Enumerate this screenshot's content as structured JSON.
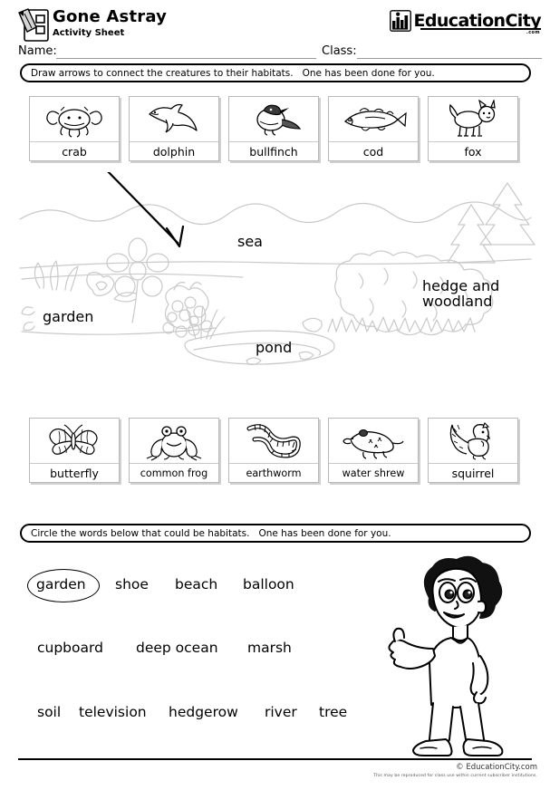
{
  "header": {
    "title": "Gone Astray",
    "subtitle": "Activity Sheet",
    "name_label": "Name:",
    "class_label": "Class:",
    "brand": "EducationCity",
    "brand_tld": ".com",
    "logo_icon": "pencil-clipboard-icon",
    "brand_icon": "cityscape-icon"
  },
  "instructions": {
    "task1": "Draw arrows to connect the creatures to their habitats.   One has been done for you.",
    "task2": "Circle the words below that could be habitats.   One has been done for you."
  },
  "creatures_top": [
    {
      "label": "crab",
      "icon": "crab-icon"
    },
    {
      "label": "dolphin",
      "icon": "dolphin-icon"
    },
    {
      "label": "bullfinch",
      "icon": "bullfinch-icon"
    },
    {
      "label": "cod",
      "icon": "cod-icon"
    },
    {
      "label": "fox",
      "icon": "fox-icon"
    }
  ],
  "creatures_bottom": [
    {
      "label": "butterfly",
      "icon": "butterfly-icon"
    },
    {
      "label": "common frog",
      "icon": "frog-icon"
    },
    {
      "label": "earthworm",
      "icon": "earthworm-icon"
    },
    {
      "label": "water shrew",
      "icon": "water-shrew-icon"
    },
    {
      "label": "squirrel",
      "icon": "squirrel-icon"
    }
  ],
  "scene": {
    "labels": {
      "sea": "sea",
      "garden": "garden",
      "pond": "pond",
      "hedge": "hedge and\nwoodland"
    },
    "arrow": {
      "from": "dolphin-card",
      "to": "sea-region"
    },
    "line_color": "#c9c9c9"
  },
  "wordbank": {
    "row1": [
      "garden",
      "shoe",
      "beach",
      "balloon"
    ],
    "row2": [
      "cupboard",
      "deep ocean",
      "marsh"
    ],
    "row3": [
      "soil",
      "television",
      "hedgerow",
      "river",
      "tree"
    ],
    "circled": "garden"
  },
  "mascot": {
    "icon": "cartoon-boy-thumbs-up-icon"
  },
  "footer": {
    "copyright": "© EducationCity.com",
    "disclaimer": "This may be reproduced for class use within current subscriber institutions."
  }
}
